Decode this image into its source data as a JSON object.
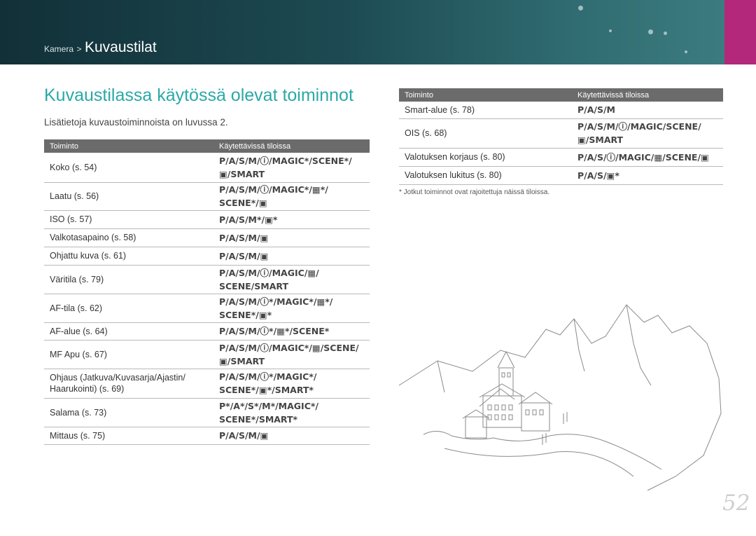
{
  "header": {
    "breadcrumb_parent": "Kamera",
    "breadcrumb_sep": ">",
    "breadcrumb_current": "Kuvaustilat"
  },
  "title": "Kuvaustilassa käytössä olevat toiminnot",
  "subtitle": "Lisätietoja kuvaustoiminnoista on luvussa 2.",
  "table_left": {
    "headers": [
      "Toiminto",
      "Käytettävissä tiloissa"
    ],
    "rows": [
      {
        "feature": "Koko (s. 54)",
        "modes": [
          "P/A/S/M/ⓘ/MAGIC*/SCENE*/",
          "▣/SMART"
        ]
      },
      {
        "feature": "Laatu (s. 56)",
        "modes": [
          "P/A/S/M/ⓘ/MAGIC*/▦*/",
          "SCENE*/▣"
        ]
      },
      {
        "feature": "ISO (s. 57)",
        "modes": [
          "P/A/S/M*/▣*"
        ]
      },
      {
        "feature": "Valkotasapaino (s. 58)",
        "modes": [
          "P/A/S/M/▣"
        ]
      },
      {
        "feature": "Ohjattu kuva (s. 61)",
        "modes": [
          "P/A/S/M/▣"
        ]
      },
      {
        "feature": "Väritila (s. 79)",
        "modes": [
          "P/A/S/M/ⓘ/MAGIC/▦/",
          "SCENE/SMART"
        ]
      },
      {
        "feature": "AF-tila (s. 62)",
        "modes": [
          "P/A/S/M/ⓘ*/MAGIC*/▦*/",
          "SCENE*/▣*"
        ]
      },
      {
        "feature": "AF-alue (s. 64)",
        "modes": [
          "P/A/S/M/ⓘ*/▦*/SCENE*"
        ]
      },
      {
        "feature": "MF Apu (s. 67)",
        "modes": [
          "P/A/S/M/ⓘ/MAGIC*/▦/SCENE/",
          "▣/SMART"
        ]
      },
      {
        "feature": "Ohjaus (Jatkuva/Kuvasarja/Ajastin/\nHaarukointi) (s. 69)",
        "modes": [
          "P/A/S/M/ⓘ*/MAGIC*/",
          "SCENE*/▣*/SMART*"
        ]
      },
      {
        "feature": "Salama (s. 73)",
        "modes": [
          "P*/A*/S*/M*/MAGIC*/",
          "SCENE*/SMART*"
        ]
      },
      {
        "feature": "Mittaus (s. 75)",
        "modes": [
          "P/A/S/M/▣"
        ]
      }
    ]
  },
  "table_right": {
    "headers": [
      "Toiminto",
      "Käytettävissä tiloissa"
    ],
    "rows": [
      {
        "feature": "Smart-alue (s. 78)",
        "modes": [
          "P/A/S/M"
        ]
      },
      {
        "feature": "OIS (s. 68)",
        "modes": [
          "P/A/S/M/ⓘ/MAGIC/SCENE/",
          "▣/SMART"
        ]
      },
      {
        "feature": "Valotuksen korjaus (s. 80)",
        "modes": [
          "P/A/S/ⓘ/MAGIC/▦/SCENE/▣"
        ]
      },
      {
        "feature": "Valotuksen lukitus (s. 80)",
        "modes": [
          "P/A/S/▣*"
        ]
      }
    ]
  },
  "footnote": "* Jotkut toiminnot ovat rajoitettuja näissä tiloissa.",
  "page_number": "52",
  "colors": {
    "accent": "#2aa9a7",
    "header_dark": "#123038",
    "header_tab": "#b3287a",
    "table_header": "#6b6b6b"
  },
  "illustration": "sketch of mountain village with church"
}
